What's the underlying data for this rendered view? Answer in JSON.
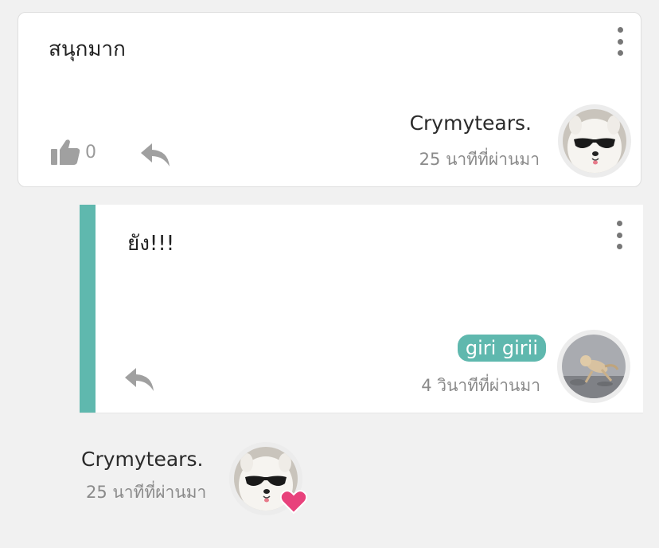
{
  "comment": {
    "text": "สนุกมาก",
    "author": "Crymytears.",
    "time": "25 นาทีที่ผ่านมา",
    "like_count": "0"
  },
  "reply": {
    "text": "ยัง!!!",
    "author": "giri girii",
    "time": "4 วินาทีที่ผ่านมา"
  },
  "footer_user": {
    "author": "Crymytears.",
    "time": "25 นาทีที่ผ่านมา"
  },
  "colors": {
    "accent": "#5fb8ae",
    "heart": "#e8427c",
    "icon_gray": "#a0a0a0"
  },
  "icons": {
    "more": "kebab-icon",
    "like": "thumbs-up-icon",
    "reply": "reply-arrow-icon",
    "reaction": "heart-icon"
  }
}
